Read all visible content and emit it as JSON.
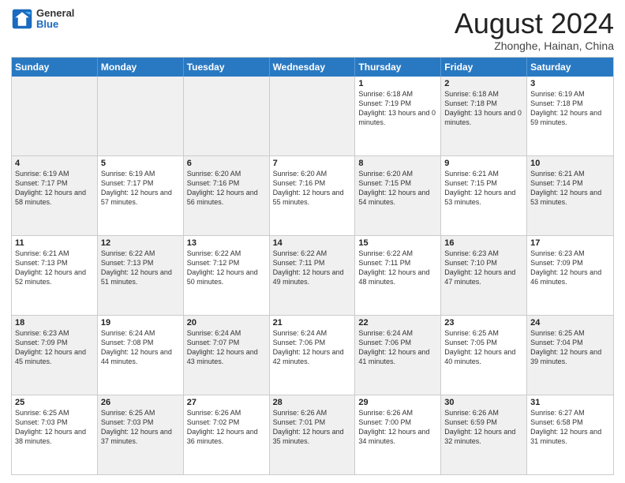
{
  "logo": {
    "line1": "General",
    "line2": "Blue"
  },
  "title": "August 2024",
  "location": "Zhonghe, Hainan, China",
  "days_of_week": [
    "Sunday",
    "Monday",
    "Tuesday",
    "Wednesday",
    "Thursday",
    "Friday",
    "Saturday"
  ],
  "weeks": [
    [
      {
        "day": "",
        "info": "",
        "shaded": true
      },
      {
        "day": "",
        "info": "",
        "shaded": true
      },
      {
        "day": "",
        "info": "",
        "shaded": true
      },
      {
        "day": "",
        "info": "",
        "shaded": true
      },
      {
        "day": "1",
        "info": "Sunrise: 6:18 AM\nSunset: 7:19 PM\nDaylight: 13 hours and 0 minutes."
      },
      {
        "day": "2",
        "info": "Sunrise: 6:18 AM\nSunset: 7:18 PM\nDaylight: 13 hours and 0 minutes.",
        "shaded": true
      },
      {
        "day": "3",
        "info": "Sunrise: 6:19 AM\nSunset: 7:18 PM\nDaylight: 12 hours and 59 minutes."
      }
    ],
    [
      {
        "day": "4",
        "info": "Sunrise: 6:19 AM\nSunset: 7:17 PM\nDaylight: 12 hours and 58 minutes.",
        "shaded": true
      },
      {
        "day": "5",
        "info": "Sunrise: 6:19 AM\nSunset: 7:17 PM\nDaylight: 12 hours and 57 minutes."
      },
      {
        "day": "6",
        "info": "Sunrise: 6:20 AM\nSunset: 7:16 PM\nDaylight: 12 hours and 56 minutes.",
        "shaded": true
      },
      {
        "day": "7",
        "info": "Sunrise: 6:20 AM\nSunset: 7:16 PM\nDaylight: 12 hours and 55 minutes."
      },
      {
        "day": "8",
        "info": "Sunrise: 6:20 AM\nSunset: 7:15 PM\nDaylight: 12 hours and 54 minutes.",
        "shaded": true
      },
      {
        "day": "9",
        "info": "Sunrise: 6:21 AM\nSunset: 7:15 PM\nDaylight: 12 hours and 53 minutes."
      },
      {
        "day": "10",
        "info": "Sunrise: 6:21 AM\nSunset: 7:14 PM\nDaylight: 12 hours and 53 minutes.",
        "shaded": true
      }
    ],
    [
      {
        "day": "11",
        "info": "Sunrise: 6:21 AM\nSunset: 7:13 PM\nDaylight: 12 hours and 52 minutes."
      },
      {
        "day": "12",
        "info": "Sunrise: 6:22 AM\nSunset: 7:13 PM\nDaylight: 12 hours and 51 minutes.",
        "shaded": true
      },
      {
        "day": "13",
        "info": "Sunrise: 6:22 AM\nSunset: 7:12 PM\nDaylight: 12 hours and 50 minutes."
      },
      {
        "day": "14",
        "info": "Sunrise: 6:22 AM\nSunset: 7:11 PM\nDaylight: 12 hours and 49 minutes.",
        "shaded": true
      },
      {
        "day": "15",
        "info": "Sunrise: 6:22 AM\nSunset: 7:11 PM\nDaylight: 12 hours and 48 minutes."
      },
      {
        "day": "16",
        "info": "Sunrise: 6:23 AM\nSunset: 7:10 PM\nDaylight: 12 hours and 47 minutes.",
        "shaded": true
      },
      {
        "day": "17",
        "info": "Sunrise: 6:23 AM\nSunset: 7:09 PM\nDaylight: 12 hours and 46 minutes."
      }
    ],
    [
      {
        "day": "18",
        "info": "Sunrise: 6:23 AM\nSunset: 7:09 PM\nDaylight: 12 hours and 45 minutes.",
        "shaded": true
      },
      {
        "day": "19",
        "info": "Sunrise: 6:24 AM\nSunset: 7:08 PM\nDaylight: 12 hours and 44 minutes."
      },
      {
        "day": "20",
        "info": "Sunrise: 6:24 AM\nSunset: 7:07 PM\nDaylight: 12 hours and 43 minutes.",
        "shaded": true
      },
      {
        "day": "21",
        "info": "Sunrise: 6:24 AM\nSunset: 7:06 PM\nDaylight: 12 hours and 42 minutes."
      },
      {
        "day": "22",
        "info": "Sunrise: 6:24 AM\nSunset: 7:06 PM\nDaylight: 12 hours and 41 minutes.",
        "shaded": true
      },
      {
        "day": "23",
        "info": "Sunrise: 6:25 AM\nSunset: 7:05 PM\nDaylight: 12 hours and 40 minutes."
      },
      {
        "day": "24",
        "info": "Sunrise: 6:25 AM\nSunset: 7:04 PM\nDaylight: 12 hours and 39 minutes.",
        "shaded": true
      }
    ],
    [
      {
        "day": "25",
        "info": "Sunrise: 6:25 AM\nSunset: 7:03 PM\nDaylight: 12 hours and 38 minutes."
      },
      {
        "day": "26",
        "info": "Sunrise: 6:25 AM\nSunset: 7:03 PM\nDaylight: 12 hours and 37 minutes.",
        "shaded": true
      },
      {
        "day": "27",
        "info": "Sunrise: 6:26 AM\nSunset: 7:02 PM\nDaylight: 12 hours and 36 minutes."
      },
      {
        "day": "28",
        "info": "Sunrise: 6:26 AM\nSunset: 7:01 PM\nDaylight: 12 hours and 35 minutes.",
        "shaded": true
      },
      {
        "day": "29",
        "info": "Sunrise: 6:26 AM\nSunset: 7:00 PM\nDaylight: 12 hours and 34 minutes."
      },
      {
        "day": "30",
        "info": "Sunrise: 6:26 AM\nSunset: 6:59 PM\nDaylight: 12 hours and 32 minutes.",
        "shaded": true
      },
      {
        "day": "31",
        "info": "Sunrise: 6:27 AM\nSunset: 6:58 PM\nDaylight: 12 hours and 31 minutes."
      }
    ]
  ]
}
